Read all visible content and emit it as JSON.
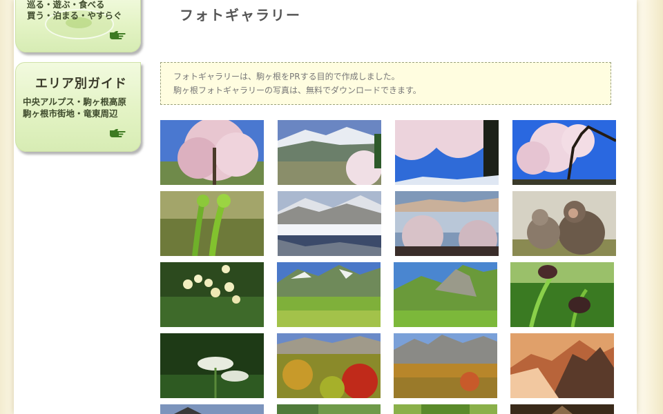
{
  "sidebar": {
    "top_box": {
      "line1": "巡る・遊ぶ・食べる",
      "line2": "買う・泊まる・やすらぐ",
      "pointer_icon": "hand-pointer-icon"
    },
    "area_box": {
      "title": "エリア別ガイド",
      "line1": "中央アルプス・駒ヶ根高原",
      "line2": "駒ヶ根市街地・竜東周辺",
      "pointer_icon": "hand-pointer-icon"
    }
  },
  "main": {
    "title": "フォトギャラリー",
    "notice": {
      "line1": "フォトギャラリーは、駒ヶ根をPRする目的で作成しました。",
      "line2": "駒ヶ根フォトギャラリーの写真は、無料でダウンロードできます。"
    }
  },
  "gallery": {
    "photos": [
      {
        "subject": "weeping-cherry-tree"
      },
      {
        "subject": "snowy-alps-with-cherry"
      },
      {
        "subject": "cherry-blossom-branches"
      },
      {
        "subject": "cherry-tree-blue-sky"
      },
      {
        "subject": "fern-fiddleheads"
      },
      {
        "subject": "snowy-mountain-reflection"
      },
      {
        "subject": "frosted-tree-valley"
      },
      {
        "subject": "snow-monkeys"
      },
      {
        "subject": "white-alpine-flowers"
      },
      {
        "subject": "green-cirque-meadow"
      },
      {
        "subject": "mountain-slope-summer"
      },
      {
        "subject": "purple-lily-flower"
      },
      {
        "subject": "white-umbel-flowers"
      },
      {
        "subject": "autumn-red-foliage"
      },
      {
        "subject": "autumn-cirque"
      },
      {
        "subject": "sunset-snow-peaks"
      }
    ]
  }
}
